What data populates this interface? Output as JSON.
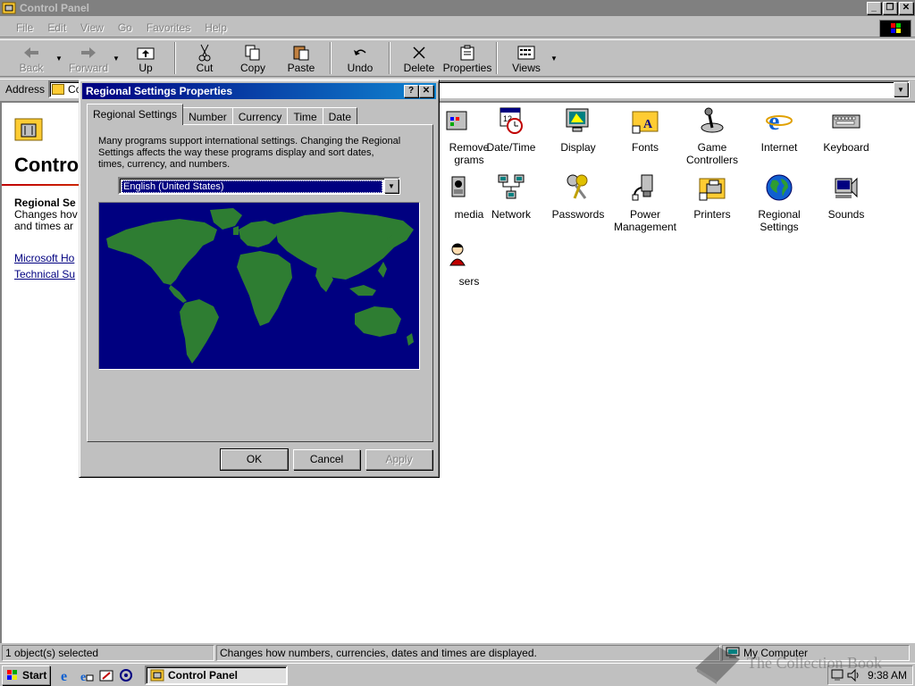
{
  "window": {
    "title": "Control Panel",
    "caption_buttons": [
      "_",
      "❐",
      "✕"
    ]
  },
  "menu": [
    "File",
    "Edit",
    "View",
    "Go",
    "Favorites",
    "Help"
  ],
  "toolbar": {
    "back": "Back",
    "forward": "Forward",
    "up": "Up",
    "cut": "Cut",
    "copy": "Copy",
    "paste": "Paste",
    "undo": "Undo",
    "delete": "Delete",
    "properties": "Properties",
    "views": "Views"
  },
  "address": {
    "label": "Address",
    "value": "Co"
  },
  "left_pane": {
    "title": "Contro",
    "selected_name": "Regional Se",
    "selected_desc": "Changes hov\nand times ar",
    "links": [
      "Microsoft Ho",
      "Technical Su"
    ]
  },
  "icons": {
    "add_remove": "Remove\ngrams",
    "datetime": "Date/Time",
    "display": "Display",
    "fonts": "Fonts",
    "game_controllers": "Game\nControllers",
    "internet": "Internet",
    "keyboard": "Keyboard",
    "multimedia": "media",
    "network": "Network",
    "passwords": "Passwords",
    "power": "Power\nManagement",
    "printers": "Printers",
    "regional": "Regional\nSettings",
    "sounds": "Sounds",
    "users": "sers"
  },
  "dialog": {
    "title": "Regional Settings Properties",
    "help_btn": "?",
    "close_btn": "✕",
    "tabs": [
      "Regional Settings",
      "Number",
      "Currency",
      "Time",
      "Date"
    ],
    "intro": "Many programs support international settings. Changing the Regional Settings affects the way these programs display and sort dates, times, currency, and numbers.",
    "locale": "English (United States)",
    "ok": "OK",
    "cancel": "Cancel",
    "apply": "Apply"
  },
  "status": {
    "selection": "1 object(s) selected",
    "description": "Changes how numbers, currencies, dates and times are displayed.",
    "zone": "My Computer"
  },
  "taskbar": {
    "start": "Start",
    "task": "Control Panel",
    "clock": "9:38 AM"
  },
  "watermark": "The Collection Book",
  "colors": {
    "titlebar_inactive": "#808080",
    "dialog_title_start": "#000080",
    "dialog_title_end": "#1084d0",
    "map_ocean": "#000080",
    "map_land": "#2e7d32"
  }
}
